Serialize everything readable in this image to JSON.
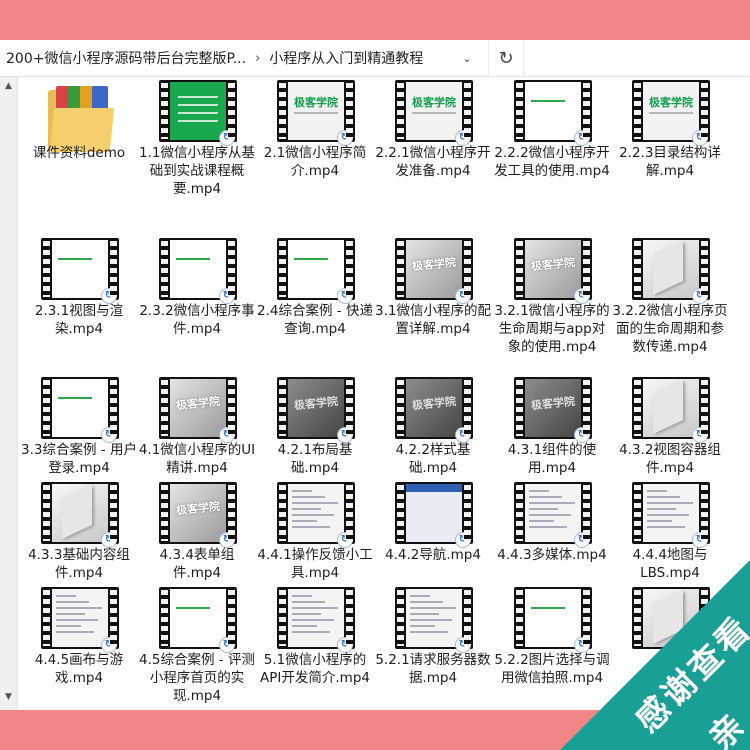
{
  "address_bar": {
    "crumbs": [
      "200+微信小程序源码带后台完整版P...",
      "小程序从入门到精通教程"
    ],
    "separator": "›",
    "dropdown": "⌄",
    "refresh": "↻"
  },
  "scrollbar": {
    "up": "▲",
    "down": "▼"
  },
  "files": [
    {
      "label": "课件资料demo",
      "kind": "folder"
    },
    {
      "label": "1.1微信小程序从基础到实战课程概要.mp4",
      "kind": "video",
      "thumb": "green"
    },
    {
      "label": "2.1微信小程序简介.mp4",
      "kind": "video",
      "thumb": "jike"
    },
    {
      "label": "2.2.1微信小程序开发准备.mp4",
      "kind": "video",
      "thumb": "jike"
    },
    {
      "label": "2.2.2微信小程序开发工具的使用.mp4",
      "kind": "video",
      "thumb": "white"
    },
    {
      "label": "2.2.3目录结构详解.mp4",
      "kind": "video",
      "thumb": "jike"
    },
    {
      "label": "2.3.1视图与渲染.mp4",
      "kind": "video",
      "thumb": "white"
    },
    {
      "label": "2.3.2微信小程序事件.mp4",
      "kind": "video",
      "thumb": "white"
    },
    {
      "label": "2.4综合案例 - 快递查询.mp4",
      "kind": "video",
      "thumb": "white"
    },
    {
      "label": "3.1微信小程序的配置详解.mp4",
      "kind": "video",
      "thumb": "gray"
    },
    {
      "label": "3.2.1微信小程序的生命周期与app对象的使用.mp4",
      "kind": "video",
      "thumb": "gray"
    },
    {
      "label": "3.2.2微信小程序页面的生命周期和参数传递.mp4",
      "kind": "video",
      "thumb": "slab"
    },
    {
      "label": "3.3综合案例 - 用户登录.mp4",
      "kind": "video",
      "thumb": "white"
    },
    {
      "label": "4.1微信小程序的UI精讲.mp4",
      "kind": "video",
      "thumb": "gray"
    },
    {
      "label": "4.2.1布局基础.mp4",
      "kind": "video",
      "thumb": "dark"
    },
    {
      "label": "4.2.2样式基础.mp4",
      "kind": "video",
      "thumb": "dark"
    },
    {
      "label": "4.3.1组件的使用.mp4",
      "kind": "video",
      "thumb": "dark"
    },
    {
      "label": "4.3.2视图容器组件.mp4",
      "kind": "video",
      "thumb": "slab"
    },
    {
      "label": "4.3.3基础内容组件.mp4",
      "kind": "video",
      "thumb": "slab"
    },
    {
      "label": "4.3.4表单组件.mp4",
      "kind": "video",
      "thumb": "gray"
    },
    {
      "label": "4.4.1操作反馈小工具.mp4",
      "kind": "video",
      "thumb": "doc"
    },
    {
      "label": "4.4.2导航.mp4",
      "kind": "video",
      "thumb": "blue"
    },
    {
      "label": "4.4.3多媒体.mp4",
      "kind": "video",
      "thumb": "doc"
    },
    {
      "label": "4.4.4地图与LBS.mp4",
      "kind": "video",
      "thumb": "doc"
    },
    {
      "label": "4.4.5画布与游戏.mp4",
      "kind": "video",
      "thumb": "doc"
    },
    {
      "label": "4.5综合案例 - 评测小程序首页的实现.mp4",
      "kind": "video",
      "thumb": "white"
    },
    {
      "label": "5.1微信小程序的API开发简介.mp4",
      "kind": "video",
      "thumb": "doc"
    },
    {
      "label": "5.2.1请求服务器数据.mp4",
      "kind": "video",
      "thumb": "doc"
    },
    {
      "label": "5.2.2图片选择与调用微信拍照.mp4",
      "kind": "video",
      "thumb": "white"
    },
    {
      "label": "",
      "kind": "video",
      "thumb": "slab"
    }
  ],
  "thumb_text": {
    "jike": "极客学院",
    "gray": "极客学院"
  },
  "watermark": {
    "text1": "感谢查看",
    "text2": "亲"
  }
}
